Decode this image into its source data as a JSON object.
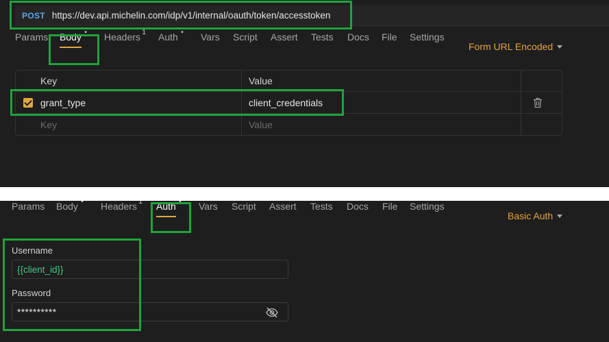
{
  "request": {
    "method": "POST",
    "url": "https://dev.api.michelin.com/idp/v1/internal/oauth/token/accesstoken"
  },
  "panel1": {
    "tabs": [
      {
        "label": "Params",
        "sup": ""
      },
      {
        "label": "Body",
        "sup": "•"
      },
      {
        "label": "Headers",
        "sup": "1"
      },
      {
        "label": "Auth",
        "sup": "•"
      },
      {
        "label": "Vars",
        "sup": ""
      },
      {
        "label": "Script",
        "sup": ""
      },
      {
        "label": "Assert",
        "sup": ""
      },
      {
        "label": "Tests",
        "sup": ""
      },
      {
        "label": "Docs",
        "sup": ""
      },
      {
        "label": "File",
        "sup": ""
      },
      {
        "label": "Settings",
        "sup": ""
      }
    ],
    "active_tab": "Body",
    "mode": "Form URL Encoded",
    "table": {
      "headers": {
        "key": "Key",
        "value": "Value"
      },
      "rows": [
        {
          "enabled": true,
          "key": "grant_type",
          "value": "client_credentials"
        }
      ],
      "new_row": {
        "key_placeholder": "Key",
        "value_placeholder": "Value"
      }
    }
  },
  "panel2": {
    "tabs": [
      {
        "label": "Params",
        "sup": ""
      },
      {
        "label": "Body",
        "sup": "•"
      },
      {
        "label": "Headers",
        "sup": "1"
      },
      {
        "label": "Auth",
        "sup": "•"
      },
      {
        "label": "Vars",
        "sup": ""
      },
      {
        "label": "Script",
        "sup": ""
      },
      {
        "label": "Assert",
        "sup": ""
      },
      {
        "label": "Tests",
        "sup": ""
      },
      {
        "label": "Docs",
        "sup": ""
      },
      {
        "label": "File",
        "sup": ""
      },
      {
        "label": "Settings",
        "sup": ""
      }
    ],
    "active_tab": "Auth",
    "mode": "Basic Auth",
    "auth": {
      "username_label": "Username",
      "username_value": "{{client_id}}",
      "password_label": "Password",
      "password_value": "**********"
    }
  },
  "colors": {
    "highlight": "#1fa33a",
    "accent": "#e0a743",
    "method": "#5aa7e8",
    "variable": "#41c98a"
  },
  "icons": {
    "trash": "trash-icon",
    "eye_off": "eye-off-icon",
    "caret": "caret-down-icon",
    "check": "check-icon"
  }
}
